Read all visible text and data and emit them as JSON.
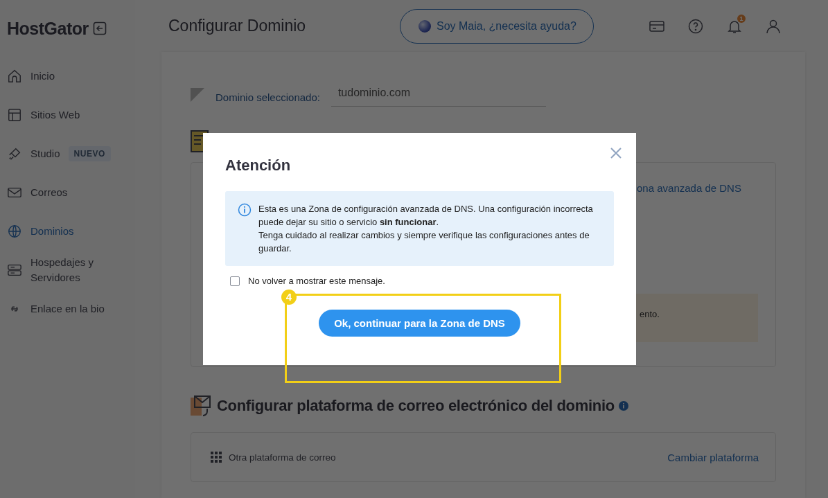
{
  "header": {
    "logo": "HostGator",
    "title": "Configurar Dominio",
    "assistant_button": "Soy Maia, ¿necesita ayuda?",
    "notification_count": "1"
  },
  "sidebar": {
    "items": [
      {
        "label": "Inicio",
        "selected": false
      },
      {
        "label": "Sitios Web",
        "selected": false
      },
      {
        "label": "Studio",
        "badge": "NUEVO",
        "selected": false
      },
      {
        "label": "Correos",
        "selected": false
      },
      {
        "label": "Dominios",
        "selected": true
      },
      {
        "label": "Hospedajes y Servidores",
        "selected": false
      },
      {
        "label": "Enlace en la bio",
        "selected": false
      }
    ]
  },
  "domain_selector": {
    "label": "Dominio seleccionado:",
    "value": "tudominio.com"
  },
  "dns_section": {
    "link_fragment": "ona avanzada de DNS",
    "notice_fragment": "ento."
  },
  "email_section": {
    "title": "Configurar plataforma de correo electrónico del dominio",
    "platform": "Otra plataforma de correo",
    "change_link": "Cambiar plataforma"
  },
  "dialog": {
    "title": "Atención",
    "paragraphs": [
      "Esta es una Zona de configuración avanzada de DNS. Una configuración incorrecta puede dejar su sitio o servicio **sin funcionar**.",
      "Tenga cuidado al realizar cambios y siempre verifique las configuraciones antes de guardar."
    ],
    "checkbox": {
      "label": "No volver a mostrar este mensaje.",
      "checked": false
    },
    "button": "Ok, continuar para la Zona de DNS"
  },
  "highlight": {
    "step": "4"
  }
}
